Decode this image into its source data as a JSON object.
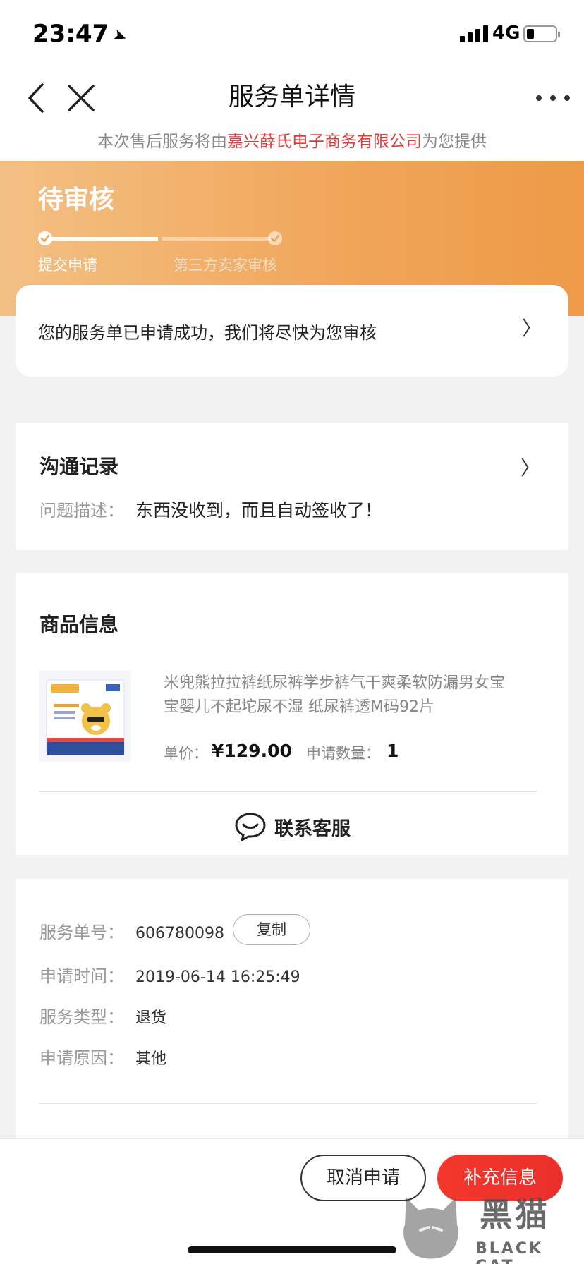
{
  "status_bar": {
    "time": "23:47",
    "network": "4G"
  },
  "nav": {
    "title": "服务单详情"
  },
  "provider": {
    "prefix": "本次售后服务将由",
    "company": "嘉兴薛氏电子商务有限公司",
    "suffix": "为您提供"
  },
  "progress": {
    "status_title": "待审核",
    "steps": [
      {
        "label": "提交申请",
        "done": true
      },
      {
        "label": "第三方卖家审核",
        "done": false
      }
    ],
    "message": "您的服务单已申请成功，我们将尽快为您审核"
  },
  "communication": {
    "title": "沟通记录",
    "issue_label": "问题描述：",
    "issue_value": "东西没收到，而且自动签收了！"
  },
  "product": {
    "section_title": "商品信息",
    "name": "米兜熊拉拉裤纸尿裤学步裤气干爽柔软防漏男女宝宝婴儿不起坨尿不湿 纸尿裤透M码92片",
    "price_label": "单价：",
    "price_value": "¥129.00",
    "qty_label": "申请数量：",
    "qty_value": "1",
    "contact_label": "联系客服"
  },
  "service_info": {
    "order_no_label": "服务单号：",
    "order_no": "606780098",
    "copy_label": "复制",
    "apply_time_label": "申请时间：",
    "apply_time": "2019-06-14 16:25:49",
    "service_type_label": "服务类型：",
    "service_type": "退货",
    "reason_label": "申请原因：",
    "reason": "其他"
  },
  "actions": {
    "cancel_label": "取消申请",
    "supplement_label": "补充信息"
  },
  "watermark": {
    "title": "黑猫",
    "subtitle": "BLACK CAT"
  },
  "colors": {
    "accent_red": "#e8302a",
    "header_orange": "#f1a559",
    "company_red": "#e23b3b"
  }
}
